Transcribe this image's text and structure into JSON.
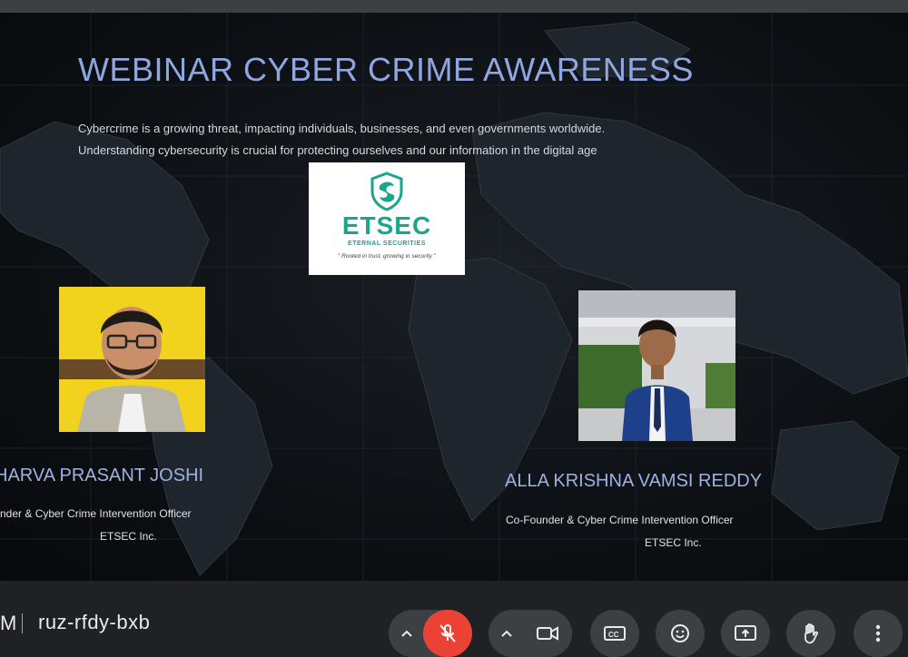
{
  "slide": {
    "title": "WEBINAR CYBER CRIME AWARENESS",
    "description_line1": "Cybercrime is a growing threat, impacting individuals, businesses, and even governments worldwide.",
    "description_line2": "Understanding cybersecurity is crucial for protecting ourselves and our information in the digital age",
    "logo": {
      "brand": "ETSEC",
      "subtitle": "ETERNAL SECURITIES",
      "tagline": "\" Rooted in trust, growing in security \"",
      "color": "#1aa68a"
    },
    "speakers": [
      {
        "name": "HARVA PRASANT JOSHI",
        "role": "nder & Cyber Crime Intervention Officer",
        "org": "ETSEC Inc."
      },
      {
        "name": "ALLA KRISHNA VAMSI REDDY",
        "role": "Co-Founder & Cyber Crime Intervention Officer",
        "org": "ETSEC Inc."
      }
    ]
  },
  "meeting": {
    "clock_fragment": "M",
    "code": "ruz-rfdy-bxb"
  },
  "controls": [
    {
      "name": "mic-options",
      "icon": "chevron-up-icon"
    },
    {
      "name": "mic-toggle",
      "icon": "mic-off-icon",
      "state": "muted"
    },
    {
      "name": "camera-options",
      "icon": "chevron-up-icon"
    },
    {
      "name": "camera-toggle",
      "icon": "video-camera-icon"
    },
    {
      "name": "captions",
      "icon": "closed-captions-icon"
    },
    {
      "name": "reactions",
      "icon": "emoji-icon"
    },
    {
      "name": "present",
      "icon": "present-screen-icon"
    },
    {
      "name": "raise-hand",
      "icon": "hand-icon"
    },
    {
      "name": "more-options",
      "icon": "more-vert-icon"
    }
  ],
  "colors": {
    "title": "#8fa6e0",
    "mute_red": "#ea4335",
    "control_bg": "#3c4043",
    "bar_bg": "#202124"
  }
}
